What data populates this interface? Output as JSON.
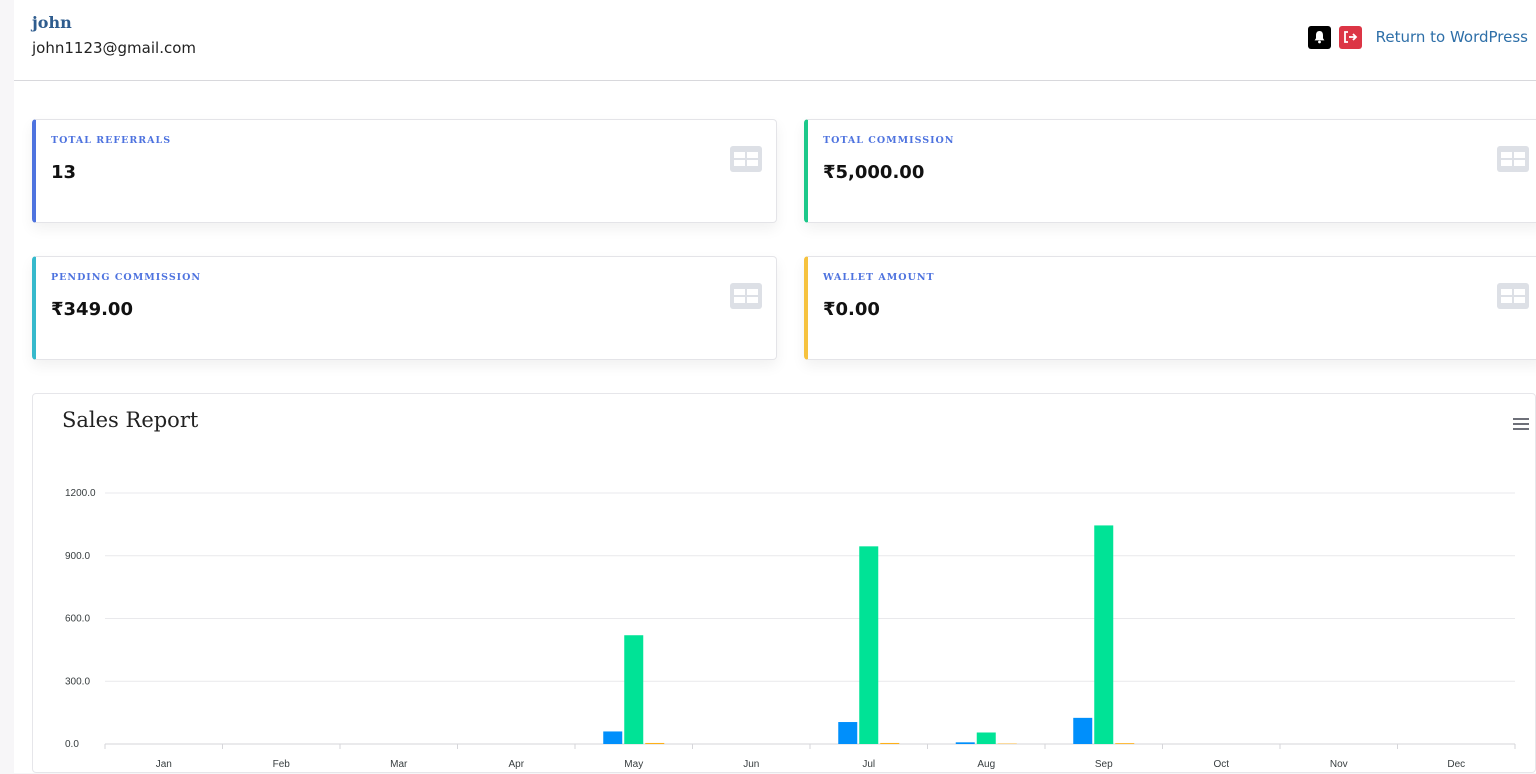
{
  "header": {
    "user_name": "john",
    "user_email": "john1123@gmail.com",
    "return_link": "Return to WordPress"
  },
  "icons": {
    "bell": "bell-icon",
    "logout": "logout-icon",
    "card": "table-icon",
    "menu": "hamburger-menu-icon"
  },
  "cards": [
    {
      "label": "TOTAL REFERRALS",
      "value": "13",
      "accent": "#4e73df"
    },
    {
      "label": "TOTAL COMMISSION",
      "value": "₹5,000.00",
      "accent": "#1cc88a"
    },
    {
      "label": "PENDING COMMISSION",
      "value": "₹349.00",
      "accent": "#36b9cc"
    },
    {
      "label": "WALLET AMOUNT",
      "value": "₹0.00",
      "accent": "#f6c23e"
    }
  ],
  "chart_title": "Sales Report",
  "chart_data": {
    "type": "bar",
    "title": "Sales Report",
    "xlabel": "",
    "ylabel": "",
    "ylim": [
      0,
      1200
    ],
    "yticks": [
      "0.0",
      "300.0",
      "600.0",
      "900.0",
      "1200.0"
    ],
    "categories": [
      "Jan",
      "Feb",
      "Mar",
      "Apr",
      "May",
      "Jun",
      "Jul",
      "Aug",
      "Sep",
      "Oct",
      "Nov",
      "Dec"
    ],
    "series": [
      {
        "color": "#008ffb",
        "values": [
          0,
          0,
          0,
          0,
          60,
          0,
          105,
          8,
          125,
          0,
          0,
          0
        ]
      },
      {
        "color": "#00e396",
        "values": [
          0,
          0,
          0,
          0,
          520,
          0,
          945,
          55,
          1045,
          0,
          0,
          0
        ]
      },
      {
        "color": "#feb019",
        "values": [
          0,
          0,
          0,
          0,
          5,
          0,
          5,
          2,
          4,
          0,
          0,
          0
        ]
      }
    ],
    "grid": true,
    "legend": "none"
  }
}
